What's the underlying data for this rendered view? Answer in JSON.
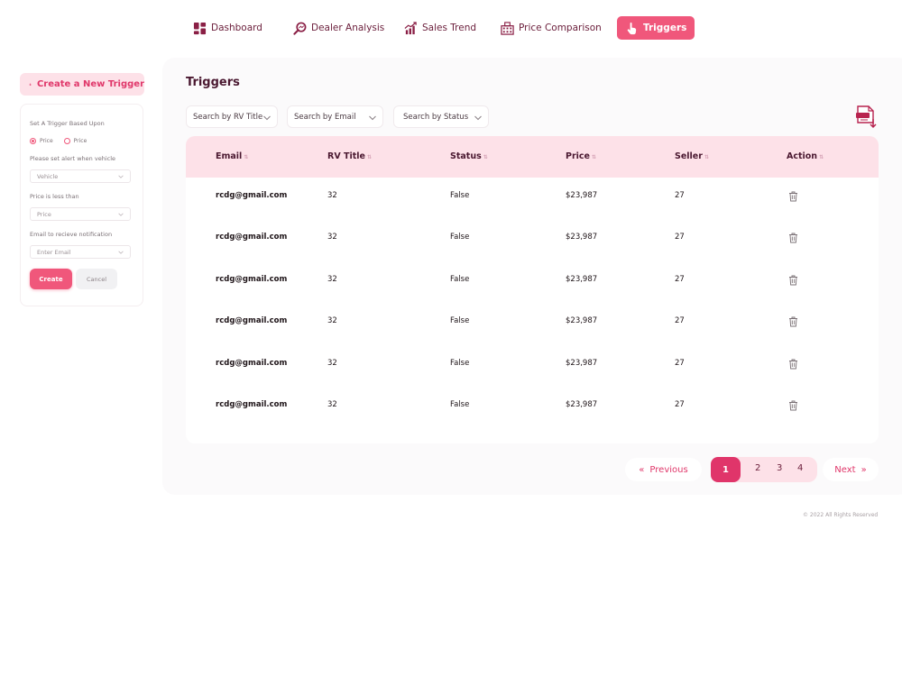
{
  "nav": {
    "dashboard": "Dashboard",
    "dealer_analysis": "Dealer Analysis",
    "sales_trend": "Sales Trend",
    "price_comparison": "Price Comparison",
    "triggers": "Triggers"
  },
  "sidebar": {
    "create_button": "Create a New Trigger",
    "form": {
      "based_upon_label": "Set A Trigger Based Upon",
      "radio_1": "Price",
      "radio_2": "Price",
      "vehicle_label": "Please set alert when vehicle",
      "vehicle_placeholder": "Vehicle",
      "price_label": "Price is less than",
      "price_placeholder": "Price",
      "email_label": "Email to recieve notification",
      "email_placeholder": "Enter Email",
      "create": "Create",
      "cancel": "Cancel"
    }
  },
  "main": {
    "title": "Triggers",
    "filters": {
      "rv_title": "Search by RV Title",
      "email": "Search by Email",
      "status": "Search by Status"
    },
    "table": {
      "headers": [
        "Email",
        "RV Title",
        "Status",
        "Price",
        "Seller",
        "Action"
      ],
      "rows": [
        [
          "rcdg@gmail.com",
          "32",
          "False",
          "$23,987",
          "27"
        ],
        [
          "rcdg@gmail.com",
          "32",
          "False",
          "$23,987",
          "27"
        ],
        [
          "rcdg@gmail.com",
          "32",
          "False",
          "$23,987",
          "27"
        ],
        [
          "rcdg@gmail.com",
          "32",
          "False",
          "$23,987",
          "27"
        ],
        [
          "rcdg@gmail.com",
          "32",
          "False",
          "$23,987",
          "27"
        ],
        [
          "rcdg@gmail.com",
          "32",
          "False",
          "$23,987",
          "27"
        ]
      ]
    },
    "pagination": {
      "previous": "Previous",
      "pages": [
        "1",
        "2",
        "3",
        "4"
      ],
      "current": "1",
      "next": "Next"
    }
  },
  "footer": "© 2022 All Rights Reserved",
  "colors": {
    "accent": "#f0577b",
    "accent_dark": "#e0356a",
    "header_pink": "#fde1e8",
    "nav_text": "#6a1d3a"
  },
  "icons": {
    "dashboard": "dashboard-grid-icon",
    "dealer_analysis": "magnifier-icon",
    "sales_trend": "trend-chart-icon",
    "price_comparison": "building-icon",
    "triggers": "hand-pointer-icon",
    "export": "export-document-icon",
    "action": "trash-icon"
  }
}
